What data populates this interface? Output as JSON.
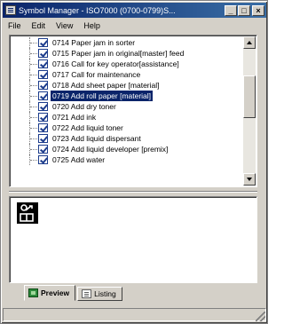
{
  "window": {
    "title": "Symbol Manager - ISO7000  (0700-0799)S..."
  },
  "menu": [
    {
      "label": "File",
      "accel": "F"
    },
    {
      "label": "Edit",
      "accel": "E"
    },
    {
      "label": "View",
      "accel": "V"
    },
    {
      "label": "Help",
      "accel": "H"
    }
  ],
  "symbols": {
    "selected_index": 5,
    "items": [
      {
        "label": "0714 Paper jam in sorter",
        "checked": true
      },
      {
        "label": "0715 Paper jam in original[master] feed",
        "checked": true
      },
      {
        "label": "0716 Call for key operator[assistance]",
        "checked": true
      },
      {
        "label": "0717 Call for maintenance",
        "checked": true
      },
      {
        "label": "0718 Add sheet paper [material]",
        "checked": true
      },
      {
        "label": "0719 Add roll paper [material]",
        "checked": true
      },
      {
        "label": "0720 Add dry toner",
        "checked": true
      },
      {
        "label": "0721 Add ink",
        "checked": true
      },
      {
        "label": "0722 Add liquid toner",
        "checked": true
      },
      {
        "label": "0723 Add liquid dispersant",
        "checked": true
      },
      {
        "label": "0724 Add liquid developer [premix]",
        "checked": true
      },
      {
        "label": "0725 Add water",
        "checked": true
      }
    ]
  },
  "tabs": [
    {
      "label": "Preview",
      "active": true,
      "icon": "preview-icon"
    },
    {
      "label": "Listing",
      "active": false,
      "icon": "listing-icon"
    }
  ],
  "colors": {
    "title_bar": "#0a246a",
    "selection": "#0a246a",
    "checkbox": "#1c3c8c",
    "preview_tab_icon": "#2e8a3c"
  }
}
